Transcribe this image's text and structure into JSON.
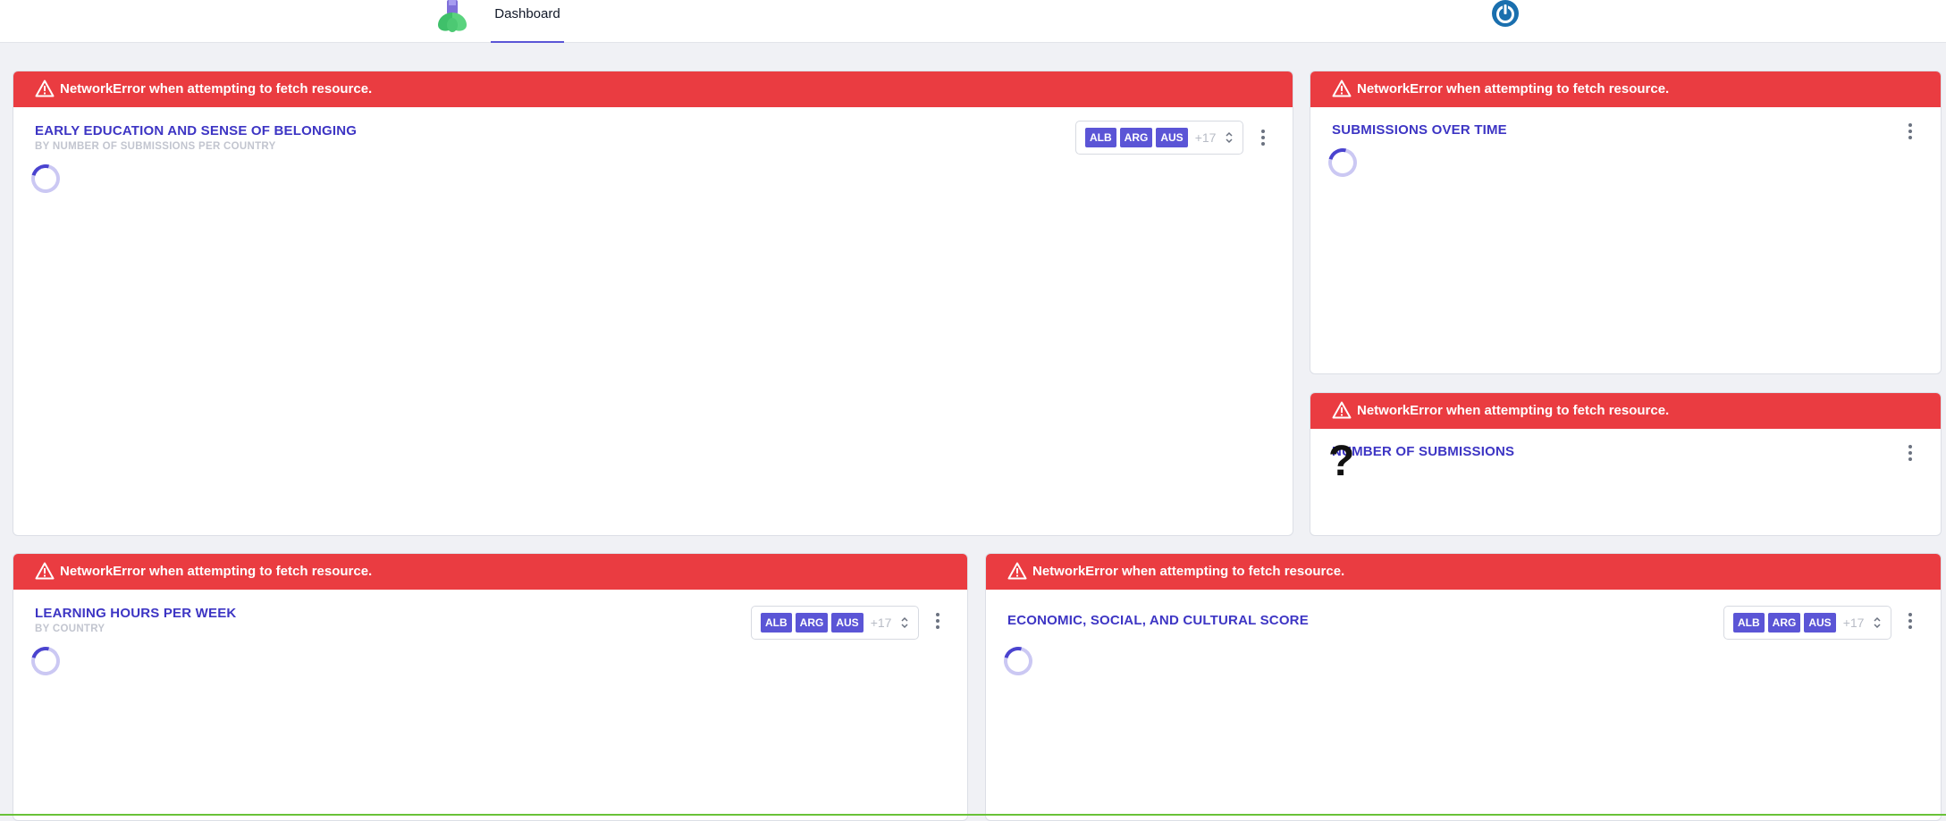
{
  "header": {
    "tab_dashboard": "Dashboard",
    "logo_icon": "tulip-logo-icon",
    "power_icon": "power-icon"
  },
  "colors": {
    "accent": "#5b55d6",
    "title": "#3d35c4",
    "error": "#ea3c41",
    "power": "#1a6fae"
  },
  "error_message": "NetworkError when attempting to fetch resource.",
  "filters": {
    "tags": [
      "ALB",
      "ARG",
      "AUS"
    ],
    "more": "+17"
  },
  "cards": {
    "early_education": {
      "title": "EARLY EDUCATION AND SENSE OF BELONGING",
      "subtitle": "BY NUMBER OF SUBMISSIONS PER COUNTRY"
    },
    "submissions_over_time": {
      "title": "SUBMISSIONS OVER TIME"
    },
    "number_of_submissions": {
      "title": "NUMBER OF SUBMISSIONS",
      "value": "?"
    },
    "learning_hours": {
      "title": "LEARNING HOURS PER WEEK",
      "subtitle": "BY COUNTRY"
    },
    "escs": {
      "title": "ECONOMIC, SOCIAL, AND CULTURAL SCORE"
    }
  }
}
